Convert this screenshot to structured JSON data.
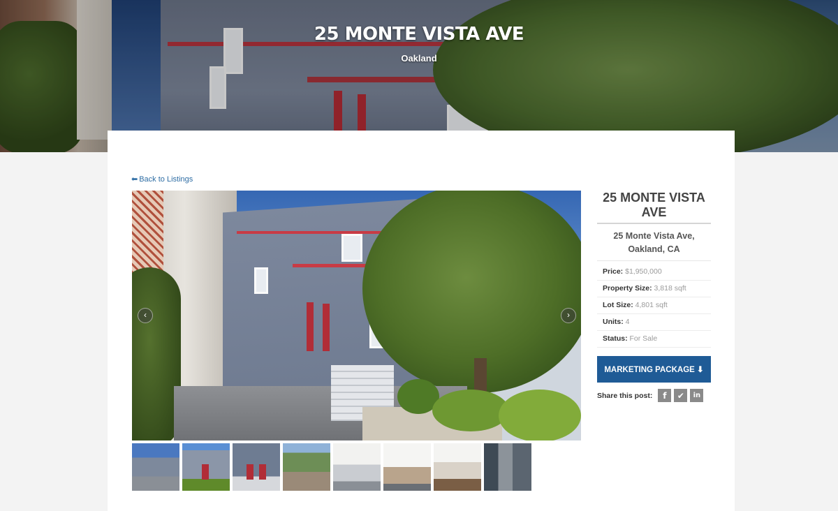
{
  "hero": {
    "title": "25 MONTE VISTA AVE",
    "city": "Oakland"
  },
  "nav": {
    "back_label": "Back to Listings"
  },
  "gallery": {
    "prev_icon": "chevron-left-icon",
    "next_icon": "chevron-right-icon",
    "thumbnail_count": 8
  },
  "sidebar": {
    "title": "25 MONTE VISTA AVE",
    "address_line1": "25 Monte Vista Ave,",
    "address_line2": "Oakland, CA",
    "facts": [
      {
        "label": "Price:",
        "value": "$1,950,000"
      },
      {
        "label": "Property Size:",
        "value": "3,818 sqft"
      },
      {
        "label": "Lot Size:",
        "value": "4,801 sqft"
      },
      {
        "label": "Units:",
        "value": "4"
      },
      {
        "label": "Status:",
        "value": "For Sale"
      }
    ],
    "button_label": "MARKETING PACKAGE",
    "share_label": "Share this post:",
    "share_icons": [
      "facebook-icon",
      "twitter-icon",
      "linkedin-icon"
    ]
  },
  "colors": {
    "accent": "#1f5b96",
    "link": "#2e6da4"
  }
}
